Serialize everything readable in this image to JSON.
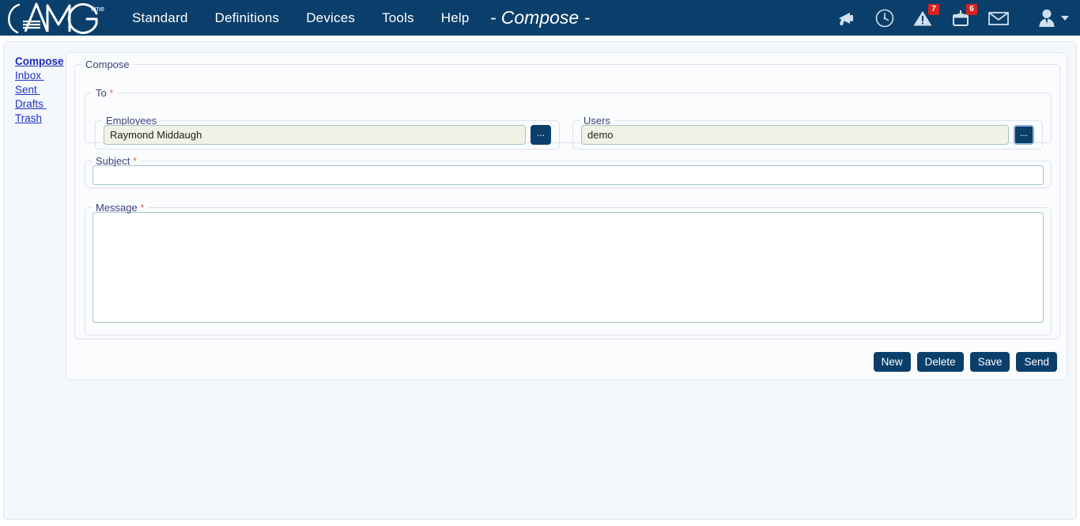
{
  "app": {
    "brand_name": "AMG",
    "brand_sup": "time",
    "title": "- Compose -",
    "colors": {
      "navy": "#0b3f6b",
      "link_blue": "#2130c8",
      "badge_red": "#d9231f",
      "required_red": "#e06a66",
      "input_filled_bg": "#f2f1e6",
      "content_bg": "#f4f7fc"
    }
  },
  "nav": {
    "items": [
      {
        "label": "Standard",
        "name": "nav-standard"
      },
      {
        "label": "Definitions",
        "name": "nav-definitions"
      },
      {
        "label": "Devices",
        "name": "nav-devices"
      },
      {
        "label": "Tools",
        "name": "nav-tools"
      },
      {
        "label": "Help",
        "name": "nav-help"
      }
    ]
  },
  "nav_icons": [
    {
      "name": "megaphone-icon",
      "badge": ""
    },
    {
      "name": "clock-icon",
      "badge": ""
    },
    {
      "name": "warning-triangle-icon",
      "badge": "7"
    },
    {
      "name": "calendar-icon",
      "badge": "6"
    },
    {
      "name": "envelope-icon",
      "badge": ""
    }
  ],
  "sidebar": {
    "items": [
      {
        "label": "Compose",
        "active": true
      },
      {
        "label": "Inbox ",
        "active": false
      },
      {
        "label": "Sent ",
        "active": false
      },
      {
        "label": "Drafts ",
        "active": false
      },
      {
        "label": "Trash",
        "active": false
      }
    ]
  },
  "form": {
    "card_legend": "Compose",
    "to_legend": "To",
    "required_mark": "*",
    "employees": {
      "legend": "Employees",
      "value": "Raymond Middaugh",
      "placeholder": "",
      "picker_label": "..."
    },
    "users": {
      "legend": "Users",
      "value": "demo",
      "placeholder": "",
      "picker_label": "..."
    },
    "subject": {
      "legend": "Subject",
      "value": "",
      "placeholder": ""
    },
    "message": {
      "legend": "Message",
      "value": "",
      "placeholder": ""
    }
  },
  "actions": {
    "new": "New",
    "delete": "Delete",
    "save": "Save",
    "send": "Send"
  }
}
